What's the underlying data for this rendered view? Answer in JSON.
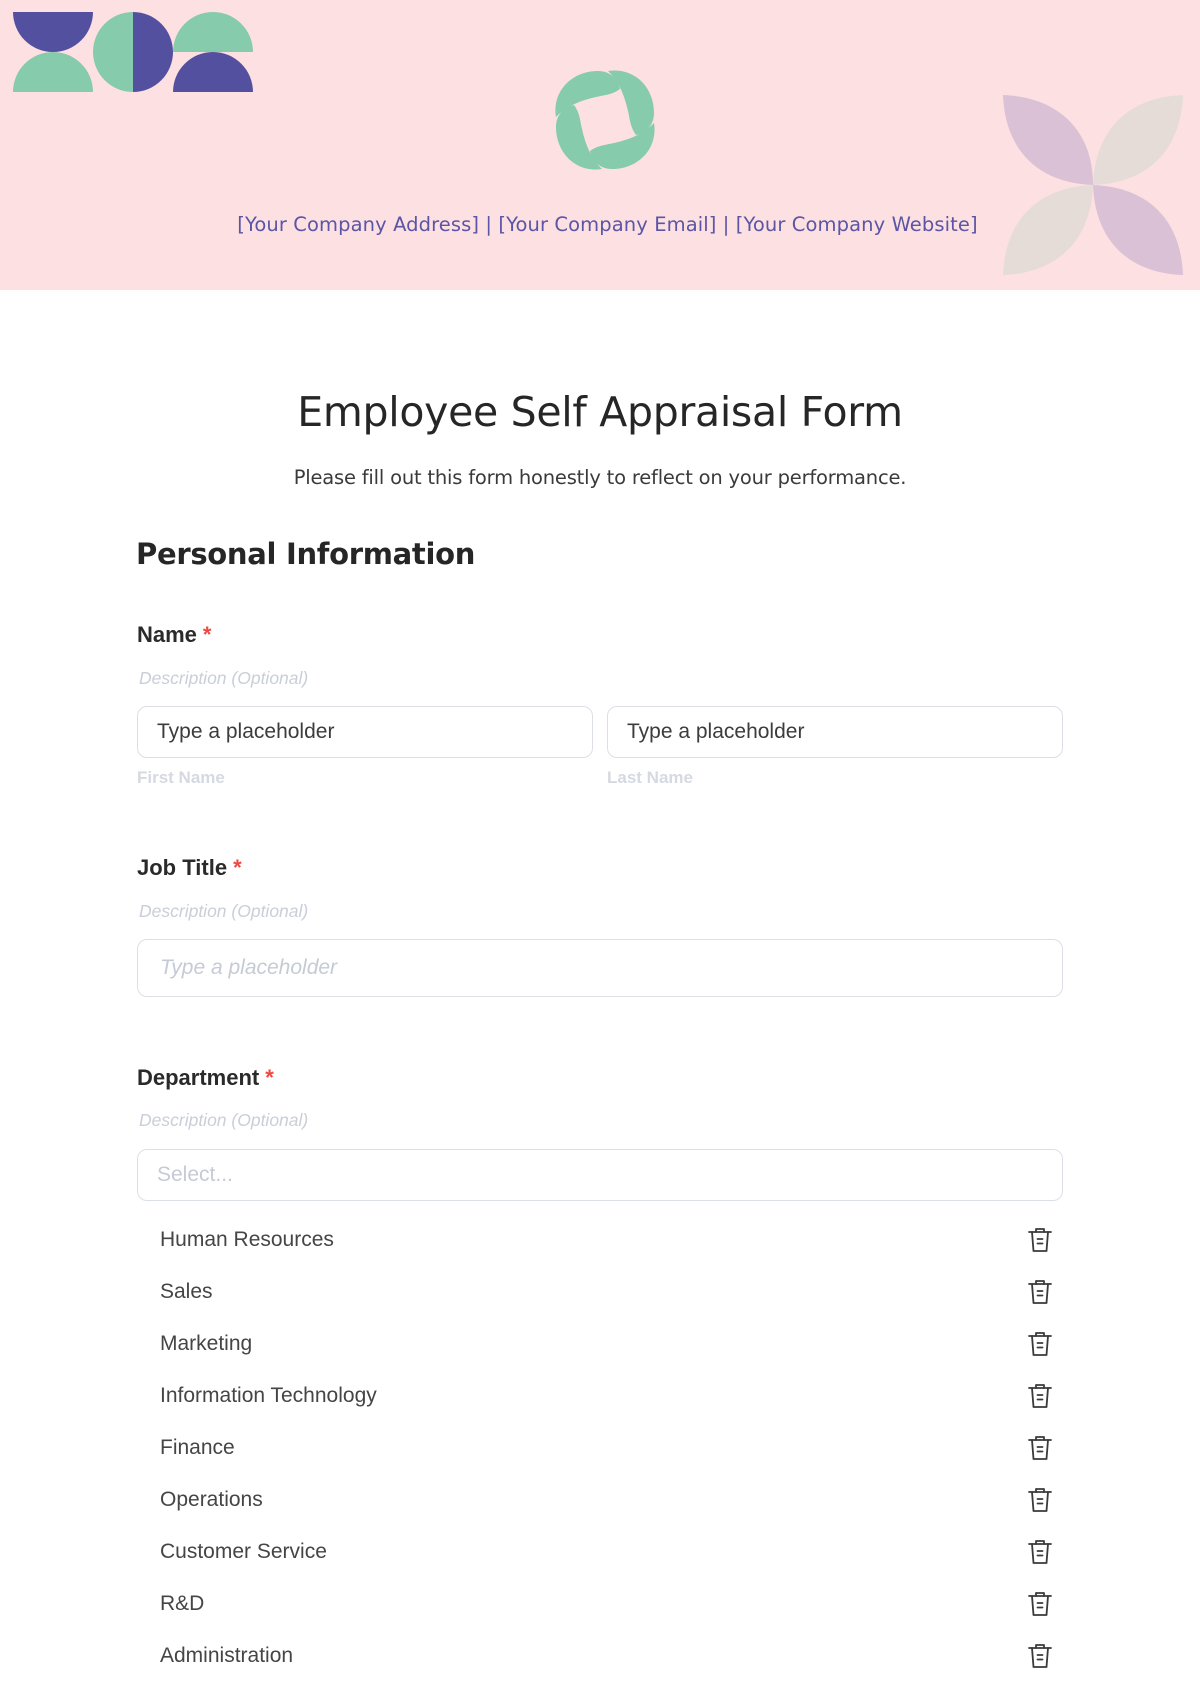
{
  "header": {
    "contact_line": "[Your Company Address] | [Your Company Email] | [Your Company Website]",
    "decorations": {
      "left": "geometric-semicircles",
      "center": "company-logo-swirl",
      "right": "four-petal-flower"
    },
    "colors": {
      "background": "#fde0e1",
      "purple": "#5450a0",
      "green": "#86cbac",
      "petal_mauve": "#dbc1d6",
      "petal_beige": "#e5dcd8",
      "contact_text": "#5a55a6"
    }
  },
  "form": {
    "title": "Employee Self Appraisal Form",
    "subtitle": "Please fill out this form honestly to reflect on your performance.",
    "section_title": "Personal Information",
    "required_mark": "*",
    "fields": {
      "name": {
        "label": "Name",
        "description": "Description (Optional)",
        "first": {
          "placeholder": "Type a placeholder",
          "sublabel": "First Name"
        },
        "last": {
          "placeholder": "Type a placeholder",
          "sublabel": "Last Name"
        }
      },
      "job_title": {
        "label": "Job Title",
        "description": "Description (Optional)",
        "placeholder": "Type a placeholder"
      },
      "department": {
        "label": "Department",
        "description": "Description (Optional)",
        "placeholder": "Select...",
        "options": [
          "Human Resources",
          "Sales",
          "Marketing",
          "Information Technology",
          "Finance",
          "Operations",
          "Customer Service",
          "R&D",
          "Administration"
        ]
      }
    }
  }
}
